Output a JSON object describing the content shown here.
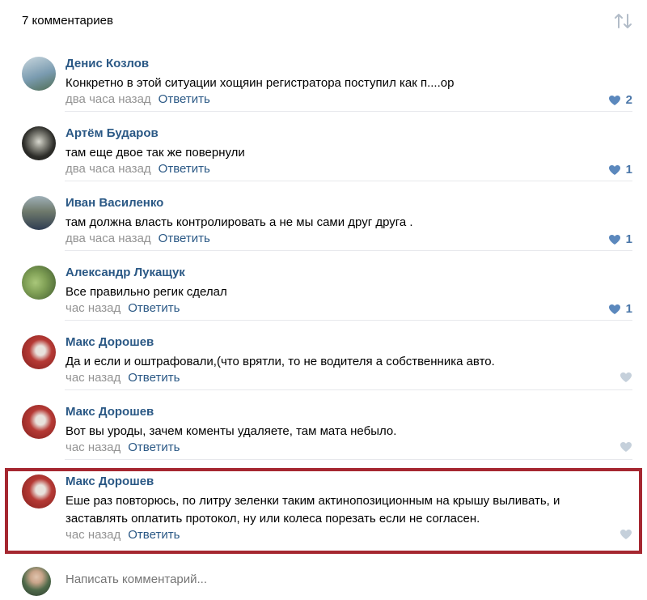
{
  "header": {
    "count_label": "7 комментариев"
  },
  "comments": [
    {
      "author": "Денис Козлов",
      "text": "Конкретно в этой ситуации хощяин регистратора поступил как п....ор",
      "time": "два часа назад",
      "reply": "Ответить",
      "likes": "2",
      "avatar_color": "#7a9bb0"
    },
    {
      "author": "Артём Бударов",
      "text": "там еще двое так же повернули",
      "time": "два часа назад",
      "reply": "Ответить",
      "likes": "1",
      "avatar_color": "#3b3b36"
    },
    {
      "author": "Иван Василенко",
      "text": "там должна власть контролировать а не мы сами друг друга .",
      "time": "два часа назад",
      "reply": "Ответить",
      "likes": "1",
      "avatar_color": "#6f7a6c"
    },
    {
      "author": "Александр Лукащук",
      "text": "Все правильно регик сделал",
      "time": "час назад",
      "reply": "Ответить",
      "likes": "1",
      "avatar_color": "#7f9f55"
    },
    {
      "author": "Макс Дорошев",
      "text": "Да и если и оштрафовали,(что врятли, то не водителя а собственника авто.",
      "time": "час назад",
      "reply": "Ответить",
      "likes": "",
      "avatar_color": "#b63a35"
    },
    {
      "author": "Макс Дорошев",
      "text": "Вот вы уроды, зачем коменты удаляете, там мата небыло.",
      "time": "час назад",
      "reply": "Ответить",
      "likes": "",
      "avatar_color": "#b63a35"
    },
    {
      "author": "Макс Дорошев",
      "text": "Еше раз повторюсь, по литру зеленки таким актинопозиционным на крышу выливать, и заставлять оплатить протокол, ну или колеса порезать если не согласен.",
      "time": "час назад",
      "reply": "Ответить",
      "likes": "",
      "avatar_color": "#b63a35"
    }
  ],
  "composer": {
    "placeholder": "Написать комментарий..."
  },
  "colors": {
    "link": "#2a5885",
    "meta": "#939393",
    "like": "#4a76a8",
    "like_empty": "#c5d0db",
    "highlight": "#a52730"
  }
}
